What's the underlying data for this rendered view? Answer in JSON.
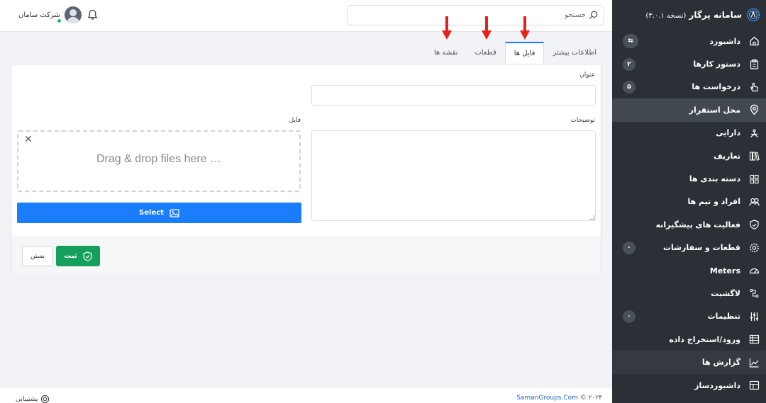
{
  "brand": {
    "title": "سامانه پرگار",
    "version": "(نسخه ۳.۰.۱)"
  },
  "header": {
    "search_placeholder": "جستجو",
    "user_name": "شرکت سامان"
  },
  "sidebar": {
    "items": [
      {
        "label": "داشبورد",
        "icon": "home-icon",
        "badge": "⇆"
      },
      {
        "label": "دستور کارها",
        "icon": "clipboard-icon",
        "badge": "۲"
      },
      {
        "label": "درخواست ها",
        "icon": "hand-icon",
        "badge": "۵"
      },
      {
        "label": "محل استقرار",
        "icon": "map-pin-icon",
        "badge": ""
      },
      {
        "label": "دارایی",
        "icon": "asset-icon",
        "badge": ""
      },
      {
        "label": "تعاریف",
        "icon": "books-icon",
        "badge": ""
      },
      {
        "label": "دسته بندی ها",
        "icon": "grid-icon",
        "badge": ""
      },
      {
        "label": "افراد و تیم ها",
        "icon": "users-icon",
        "badge": ""
      },
      {
        "label": "فعالیت های پیشگیرانه",
        "icon": "shield-icon",
        "badge": ""
      },
      {
        "label": "قطعات و سفارشات",
        "icon": "gear-icon",
        "badge": "۰"
      },
      {
        "label": "Meters",
        "icon": "gauge-icon",
        "badge": ""
      },
      {
        "label": "لاگشیت",
        "icon": "log-icon",
        "badge": ""
      },
      {
        "label": "تنظیمات",
        "icon": "sliders-icon",
        "badge": "۰"
      },
      {
        "label": "ورود/استخراج داده",
        "icon": "import-icon",
        "badge": ""
      },
      {
        "label": "گزارش ها",
        "icon": "chart-icon",
        "badge": ""
      },
      {
        "label": "داشبوردساز",
        "icon": "layout-icon",
        "badge": ""
      }
    ]
  },
  "tabs": [
    {
      "label": "اطلاعات بیشتر"
    },
    {
      "label": "فایل ها"
    },
    {
      "label": "قطعات"
    },
    {
      "label": "نقشه ها"
    }
  ],
  "form": {
    "title_label": "عنوان",
    "title_value": "",
    "description_label": "توضیحات",
    "description_value": "",
    "file_label": "فایل",
    "dropzone_text": "Drag & drop files here …",
    "select_label": "Select",
    "save_label": "ثبت",
    "close_label": "بستن"
  },
  "footer": {
    "copyright_prefix": "© ۲۰۲۴",
    "copyright_link": "SamanGroups.Com",
    "support_label": "پشتیبانی"
  },
  "colors": {
    "sidebar_bg": "#2b3036",
    "accent_blue": "#1a7dfc",
    "save_green": "#159f5c",
    "arrow_red": "#e8201b"
  }
}
